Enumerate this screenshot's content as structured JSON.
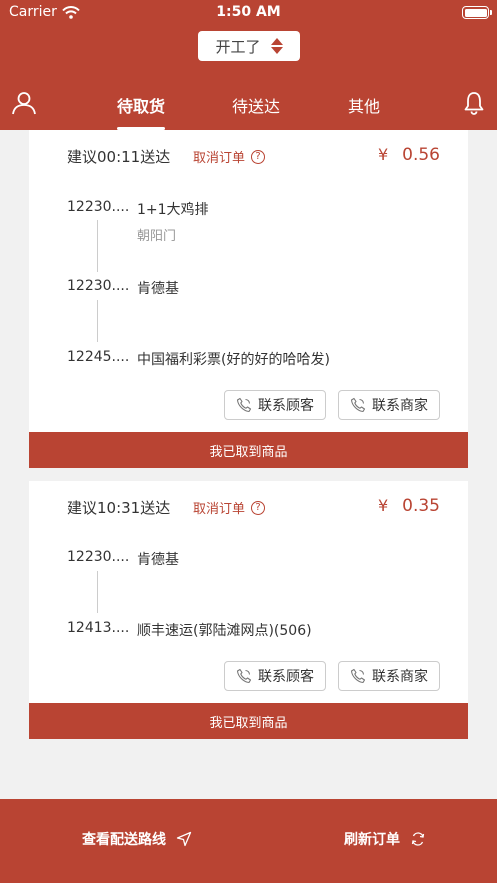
{
  "status_bar": {
    "carrier": "Carrier",
    "time": "1:50 AM"
  },
  "header": {
    "work_status": "开工了",
    "tabs": [
      {
        "label": "待取货",
        "active": true
      },
      {
        "label": "待送达",
        "active": false
      },
      {
        "label": "其他",
        "active": false
      }
    ],
    "icons": {
      "left": "user-icon",
      "right": "bell-icon"
    }
  },
  "orders": [
    {
      "eta": "建议00:11送达",
      "cancel_label": "取消订单",
      "help": "?",
      "currency": "¥",
      "price": "0.56",
      "stops": [
        {
          "num": "12230....",
          "name": "1+1大鸡排",
          "sub": "朝阳门"
        },
        {
          "num": "12230....",
          "name": "肯德基"
        },
        {
          "num": "12245....",
          "name": "中国福利彩票(好的好的哈哈发)"
        }
      ],
      "contact_customer": "联系顾客",
      "contact_merchant": "联系商家",
      "picked_label": "我已取到商品"
    },
    {
      "eta": "建议10:31送达",
      "cancel_label": "取消订单",
      "help": "?",
      "currency": "¥",
      "price": "0.35",
      "stops": [
        {
          "num": "12230....",
          "name": "肯德基"
        },
        {
          "num": "12413....",
          "name": "顺丰速运(郭陆滩网点)(506)"
        }
      ],
      "contact_customer": "联系顾客",
      "contact_merchant": "联系商家",
      "picked_label": "我已取到商品"
    }
  ],
  "bottom_bar": {
    "route_label": "查看配送路线",
    "refresh_label": "刷新订单"
  },
  "colors": {
    "brand": "#b94433",
    "background": "#f1f1f1"
  }
}
